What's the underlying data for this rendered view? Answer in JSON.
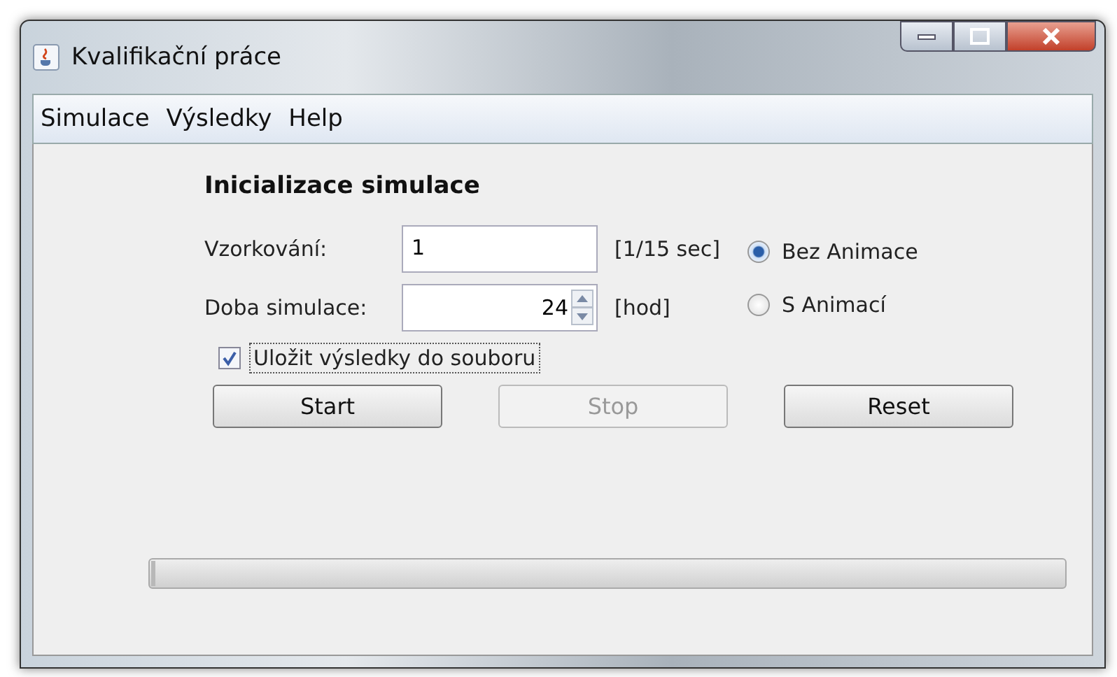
{
  "window": {
    "title": "Kvalifikační práce"
  },
  "menu": [
    "Simulace",
    "Výsledky",
    "Help"
  ],
  "heading": "Inicializace simulace",
  "fields": [
    {
      "kind": "text",
      "label": "Vzorkování:",
      "value": "1",
      "unit": "[1/15 sec]"
    },
    {
      "kind": "spinner",
      "label": "Doba simulace:",
      "value": "24",
      "unit": "[hod]"
    }
  ],
  "radios": [
    {
      "label": "Bez Animace",
      "selected": true
    },
    {
      "label": "S Animací",
      "selected": false
    }
  ],
  "checkbox": {
    "label": "Uložit výsledky do souboru",
    "checked": true
  },
  "buttons": [
    {
      "label": "Start",
      "disabled": false
    },
    {
      "label": "Stop",
      "disabled": true
    },
    {
      "label": "Reset",
      "disabled": false
    }
  ],
  "progress": {
    "level": 0
  }
}
